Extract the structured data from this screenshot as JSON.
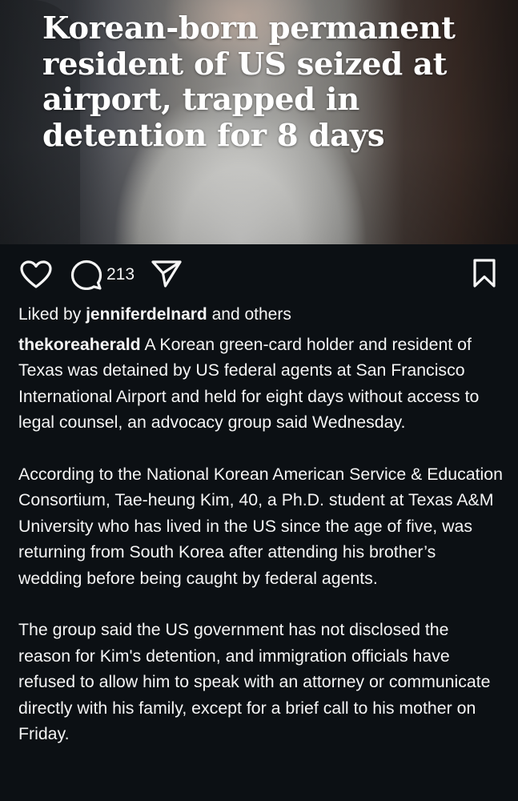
{
  "post": {
    "headline": "Korean-born permanent resident of US seized at airport, trapped in detention for 8 days"
  },
  "actions": {
    "like_icon": "heart-icon",
    "comment_icon": "comment-icon",
    "comment_count": "213",
    "share_icon": "paper-plane-icon",
    "save_icon": "bookmark-icon"
  },
  "likes": {
    "prefix": "Liked by",
    "user": "jenniferdelnard",
    "suffix": "and others"
  },
  "caption": {
    "username": "thekoreaherald",
    "paragraph1": "A Korean green-card holder and resident of Texas was detained by US federal agents at San Francisco International Airport and held for eight days without access to legal counsel, an advocacy group said Wednesday.",
    "paragraph2": "According to the National Korean American Service & Education Consortium, Tae-heung Kim, 40, a Ph.D. student at Texas A&M University who has lived in the US since the age of five, was returning from South Korea after attending his brother’s wedding before being caught by federal agents.",
    "paragraph3": "The group said the US government has not disclosed the reason for Kim's detention, and immigration officials have refused to allow him to speak with an attorney or communicate directly with his family, except for a brief call to his mother on Friday."
  },
  "theme": {
    "background": "#0c1014",
    "text": "#f5f5f5"
  }
}
